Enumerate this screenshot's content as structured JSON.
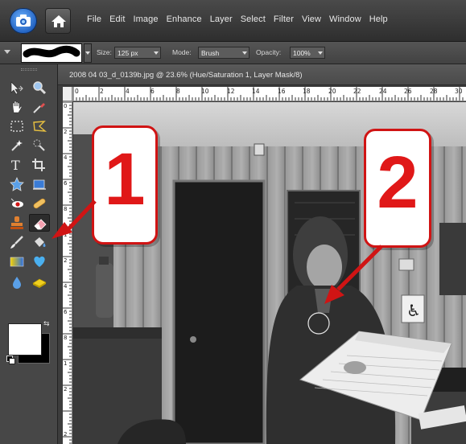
{
  "menu": {
    "items": [
      "File",
      "Edit",
      "Image",
      "Enhance",
      "Layer",
      "Select",
      "Filter",
      "View",
      "Window",
      "Help"
    ]
  },
  "options": {
    "size_label": "Size:",
    "size_value": "125 px",
    "mode_label": "Mode:",
    "mode_value": "Brush",
    "opacity_label": "Opacity:",
    "opacity_value": "100%"
  },
  "document": {
    "title": "2008 04 03_d_0139b.jpg @ 23.6% (Hue/Saturation 1, Layer Mask/8)",
    "ruler_h": [
      "0",
      "2",
      "4",
      "6",
      "8",
      "10",
      "12",
      "14",
      "16",
      "18",
      "20",
      "22",
      "24",
      "26",
      "28",
      "30"
    ],
    "ruler_v": [
      "0",
      "2",
      "4",
      "6",
      "8",
      "1",
      "2",
      "4",
      "6",
      "8",
      "1",
      "2",
      "2"
    ]
  },
  "callouts": {
    "one": "1",
    "two": "2"
  },
  "colors": {
    "accent_red": "#d01414",
    "foreground": "#ffffff",
    "background": "#000000"
  }
}
